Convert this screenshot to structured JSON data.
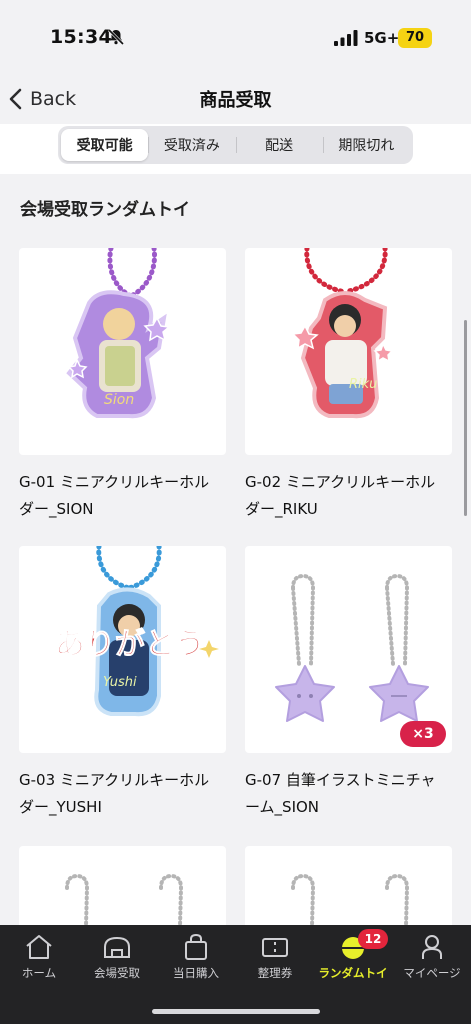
{
  "status_bar": {
    "time": "15:34",
    "network": "5G+",
    "battery": "70"
  },
  "nav": {
    "back_label": "Back",
    "title": "商品受取"
  },
  "segments": [
    {
      "label": "受取可能",
      "active": true
    },
    {
      "label": "受取済み",
      "active": false
    },
    {
      "label": "配送",
      "active": false
    },
    {
      "label": "期限切れ",
      "active": false
    }
  ],
  "section_title": "会場受取ランダムトイ",
  "products": [
    {
      "title": "G-01 ミニアクリルキーホルダー_SION",
      "badge": ""
    },
    {
      "title": "G-02 ミニアクリルキーホルダー_RIKU",
      "badge": ""
    },
    {
      "title": "G-03 ミニアクリルキーホルダー_YUSHI",
      "badge": "",
      "art_text": "ありがとう"
    },
    {
      "title": "G-07 自筆イラストミニチャーム_SION",
      "badge": "×3"
    }
  ],
  "tab_bar": {
    "items": [
      {
        "label": "ホーム",
        "icon": "home-icon"
      },
      {
        "label": "会場受取",
        "icon": "venue-icon"
      },
      {
        "label": "当日購入",
        "icon": "shopping-bag-icon"
      },
      {
        "label": "整理券",
        "icon": "ticket-icon"
      },
      {
        "label": "ランダムトイ",
        "icon": "capsule-icon",
        "badge": "12",
        "active": true
      },
      {
        "label": "マイページ",
        "icon": "person-icon"
      }
    ]
  },
  "colors": {
    "accent_yellow": "#e7ef2b",
    "badge_red": "#d8224a",
    "tab_bar_bg": "#232325"
  }
}
